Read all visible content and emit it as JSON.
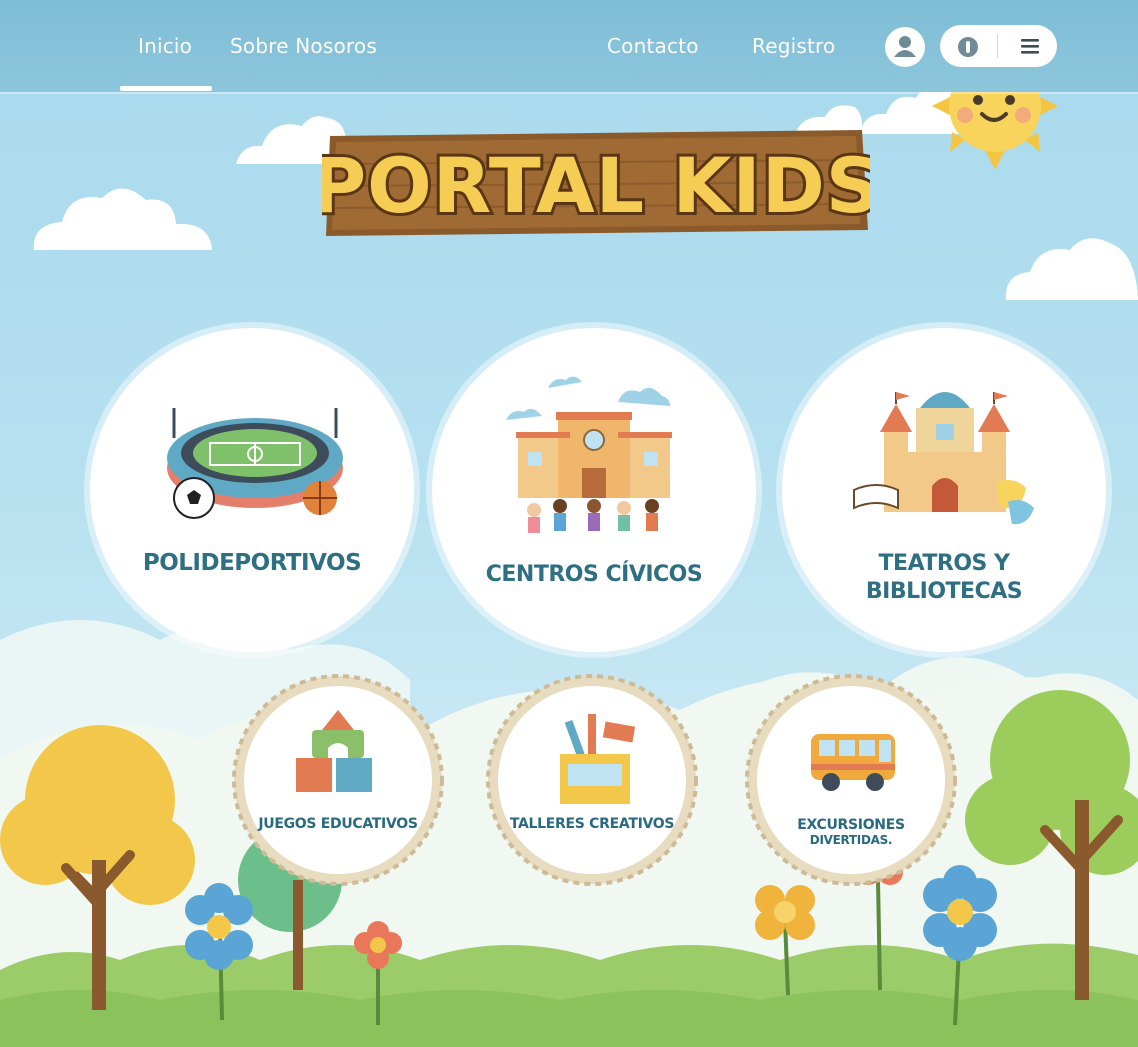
{
  "nav": {
    "items": [
      "Inicio",
      "Sobre Nosoros",
      "Contacto",
      "Registro"
    ],
    "active": "Inicio"
  },
  "header_icons": [
    "user-icon",
    "toggle-icon",
    "menu-icon"
  ],
  "logo": {
    "text": "PORTAL KIDS"
  },
  "main_cards": [
    {
      "label": "POLIDEPORTIVOS",
      "icon": "stadium-icon"
    },
    {
      "label": "CENTROS CÍVICOS",
      "icon": "civic-center-icon"
    },
    {
      "label_lines": [
        "TEATROS Y",
        "BIBLIOTECAS"
      ],
      "icon": "castle-icon"
    }
  ],
  "secondary_cards": [
    {
      "label": "JUEGOS EDUCATIVOS",
      "icon": "blocks-icon"
    },
    {
      "label": "TALLERES CREATIVOS",
      "icon": "art-supplies-icon"
    },
    {
      "label_lines": [
        "EXCURSIONES",
        "DIVERTIDAS."
      ],
      "icon": "bus-icon"
    }
  ],
  "colors": {
    "sky": "#a7d9ec",
    "nav_bar": "#84c1d9",
    "card_text": "#2e6f83",
    "wood": "#8b5a2b",
    "logo_letters": "#f6cd54"
  }
}
